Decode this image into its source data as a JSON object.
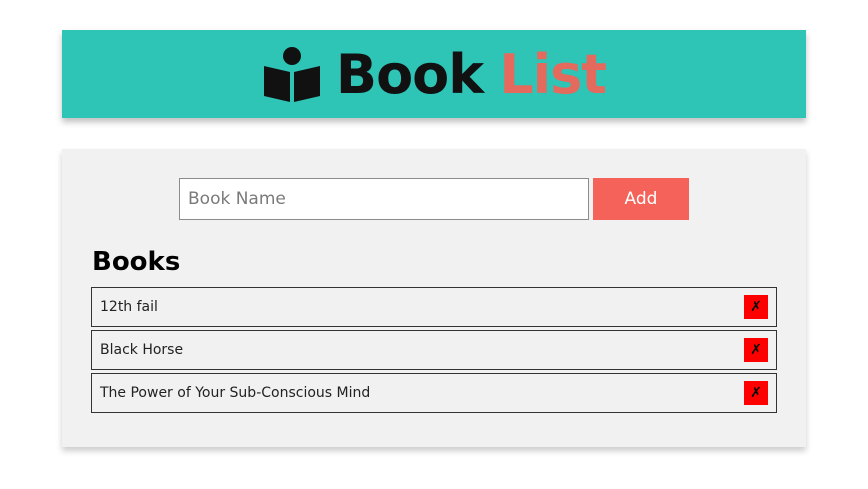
{
  "header": {
    "logo_icon": "reading-person-icon",
    "title_part1": "Book",
    "title_part2": "List",
    "background_color": "#2ec4b6",
    "accent_color": "#e46a5e"
  },
  "form": {
    "input_placeholder": "Book Name",
    "input_value": "",
    "add_label": "Add",
    "add_color": "#f4625a"
  },
  "books": {
    "heading": "Books",
    "items": [
      {
        "title": "12th fail",
        "delete_label": "✗"
      },
      {
        "title": "Black Horse",
        "delete_label": "✗"
      },
      {
        "title": "The Power of Your Sub-Conscious Mind",
        "delete_label": "✗"
      }
    ],
    "delete_color": "#ff0000"
  }
}
